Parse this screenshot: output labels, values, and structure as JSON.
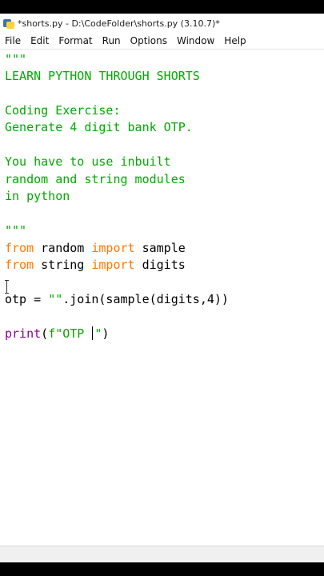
{
  "window": {
    "title": "*shorts.py - D:\\CodeFolder\\shorts.py (3.10.7)*"
  },
  "menu": [
    "File",
    "Edit",
    "Format",
    "Run",
    "Options",
    "Window",
    "Help"
  ],
  "code": {
    "line1": "\"\"\"",
    "line2": "LEARN PYTHON THROUGH SHORTS",
    "line4": "Coding Exercise:",
    "line5": "Generate 4 digit bank OTP.",
    "line7": "You have to use inbuilt",
    "line8": "random and string modules",
    "line9": "in python",
    "line11": "\"\"\"",
    "line12": {
      "kw1": "from",
      "mod": " random ",
      "kw2": "import",
      "name": " sample"
    },
    "line13": {
      "kw1": "from",
      "mod": " string ",
      "kw2": "import",
      "name": " digits"
    },
    "line15": {
      "pre": "otp = ",
      "str": "\"\"",
      "post": ".join(sample(digits,4))"
    },
    "line17": {
      "func": "print",
      "paren": "(",
      "str1": "f\"OTP ",
      "str2": "\"",
      "close": ")"
    }
  },
  "colors": {
    "string": "#00aa00",
    "keyword": "#ff7700",
    "builtin": "#900090"
  }
}
